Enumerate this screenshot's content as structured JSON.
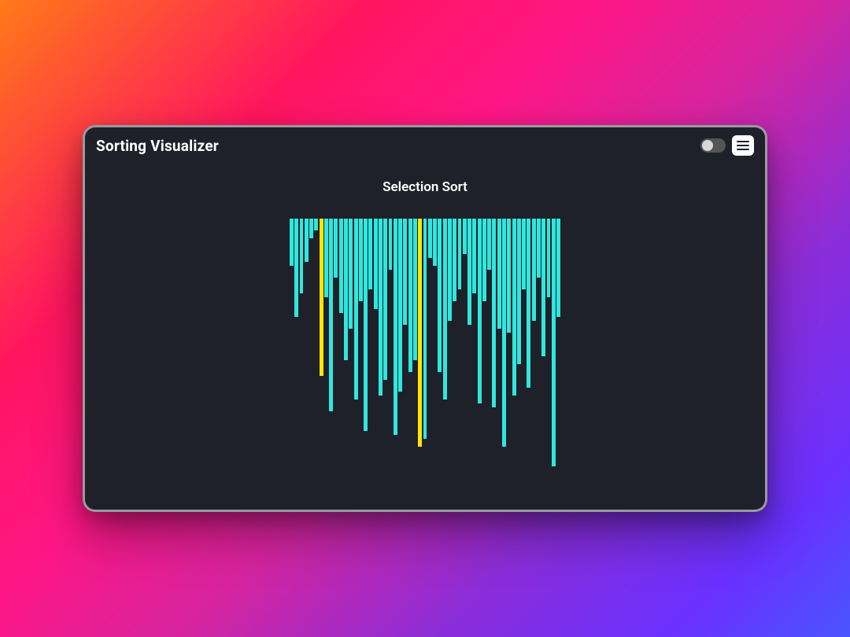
{
  "header": {
    "title": "Sorting Visualizer"
  },
  "algorithm": {
    "name": "Selection Sort"
  },
  "colors": {
    "panel_bg": "#1e2129",
    "bar_default": "#2fe7de",
    "bar_highlight": "#ffe600",
    "text": "#ffffff"
  },
  "chart_data": {
    "type": "bar",
    "title": "Selection Sort",
    "xlabel": "",
    "ylabel": "",
    "ylim": [
      0,
      320
    ],
    "categories": [],
    "values": [
      60,
      125,
      95,
      55,
      25,
      15,
      200,
      100,
      245,
      75,
      120,
      180,
      140,
      230,
      105,
      270,
      90,
      115,
      225,
      205,
      65,
      275,
      220,
      135,
      195,
      180,
      290,
      280,
      50,
      60,
      195,
      230,
      130,
      105,
      90,
      45,
      135,
      95,
      235,
      105,
      65,
      240,
      140,
      290,
      145,
      225,
      185,
      90,
      215,
      130,
      75,
      175,
      100,
      315,
      125
    ],
    "highlight_indices": [
      6,
      26
    ],
    "note": "Bars hang from the top. 'values' are pixel heights; highlighted bars are rendered yellow (current comparison)."
  }
}
